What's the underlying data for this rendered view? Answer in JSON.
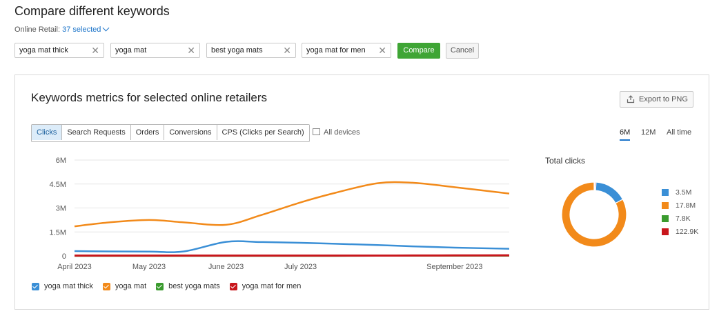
{
  "header": {
    "title": "Compare different keywords",
    "retail_label": "Online Retail:",
    "retail_selected": "37 selected"
  },
  "keywords": [
    {
      "text": "yoga mat thick"
    },
    {
      "text": "yoga mat"
    },
    {
      "text": "best yoga mats"
    },
    {
      "text": "yoga mat for men"
    }
  ],
  "remove_glyph": "✕",
  "buttons": {
    "compare": "Compare",
    "cancel": "Cancel",
    "export": "Export to PNG"
  },
  "panel": {
    "title": "Keywords metrics for selected online retailers",
    "tabs": [
      {
        "label": "Clicks",
        "active": true
      },
      {
        "label": "Search Requests",
        "active": false
      },
      {
        "label": "Orders",
        "active": false
      },
      {
        "label": "Conversions",
        "active": false
      },
      {
        "label": "CPS (Clicks per Search)",
        "active": false
      }
    ],
    "devices": "All devices",
    "ranges": [
      {
        "label": "6M",
        "active": true
      },
      {
        "label": "12M",
        "active": false
      },
      {
        "label": "All time",
        "active": false
      }
    ]
  },
  "colors": {
    "yoga_mat_thick": "#3a8fd6",
    "yoga_mat": "#f28a1a",
    "best_yoga_mats": "#3a9b2e",
    "yoga_mat_for_men": "#c8161c",
    "accent": "#1a73c9"
  },
  "chart_data": [
    {
      "type": "line",
      "x": [
        "April 2023",
        "May 2023",
        "June 2023",
        "July 2023",
        "September 2023"
      ],
      "x_dates": [
        "2023-04-01",
        "2023-04-15",
        "2023-05-01",
        "2023-05-15",
        "2023-06-01",
        "2023-06-15",
        "2023-07-01",
        "2023-07-15",
        "2023-08-01",
        "2023-08-15",
        "2023-09-01",
        "2023-09-15"
      ],
      "ylim": [
        0,
        6000000
      ],
      "yticks": [
        "0",
        "1.5M",
        "3M",
        "4.5M",
        "6M"
      ],
      "ytick_values": [
        0,
        1500000,
        3000000,
        4500000,
        6000000
      ],
      "series": [
        {
          "name": "yoga mat thick",
          "color": "#3a8fd6",
          "values": [
            300000,
            280000,
            270000,
            280000,
            880000,
            870000,
            820000,
            760000,
            680000,
            600000,
            520000,
            450000
          ]
        },
        {
          "name": "yoga mat",
          "color": "#f28a1a",
          "values": [
            1850000,
            2100000,
            2250000,
            2100000,
            1950000,
            2550000,
            3350000,
            3950000,
            4550000,
            4580000,
            4300000,
            3900000
          ]
        },
        {
          "name": "best yoga mats",
          "color": "#3a9b2e",
          "values": [
            0,
            0,
            0,
            0,
            0,
            0,
            0,
            0,
            10000,
            10000,
            10000,
            10000
          ]
        },
        {
          "name": "yoga mat for men",
          "color": "#c8161c",
          "values": [
            20000,
            20000,
            20000,
            20000,
            20000,
            20000,
            20000,
            20000,
            20000,
            25000,
            30000,
            40000
          ]
        }
      ],
      "grid": true
    },
    {
      "type": "pie",
      "title": "Total clicks",
      "labels": [
        "3.5M",
        "17.8M",
        "7.8K",
        "122.9K"
      ],
      "values": [
        3500000,
        17800000,
        7800,
        122900
      ],
      "colors": [
        "#3a8fd6",
        "#f28a1a",
        "#3a9b2e",
        "#c8161c"
      ]
    }
  ]
}
